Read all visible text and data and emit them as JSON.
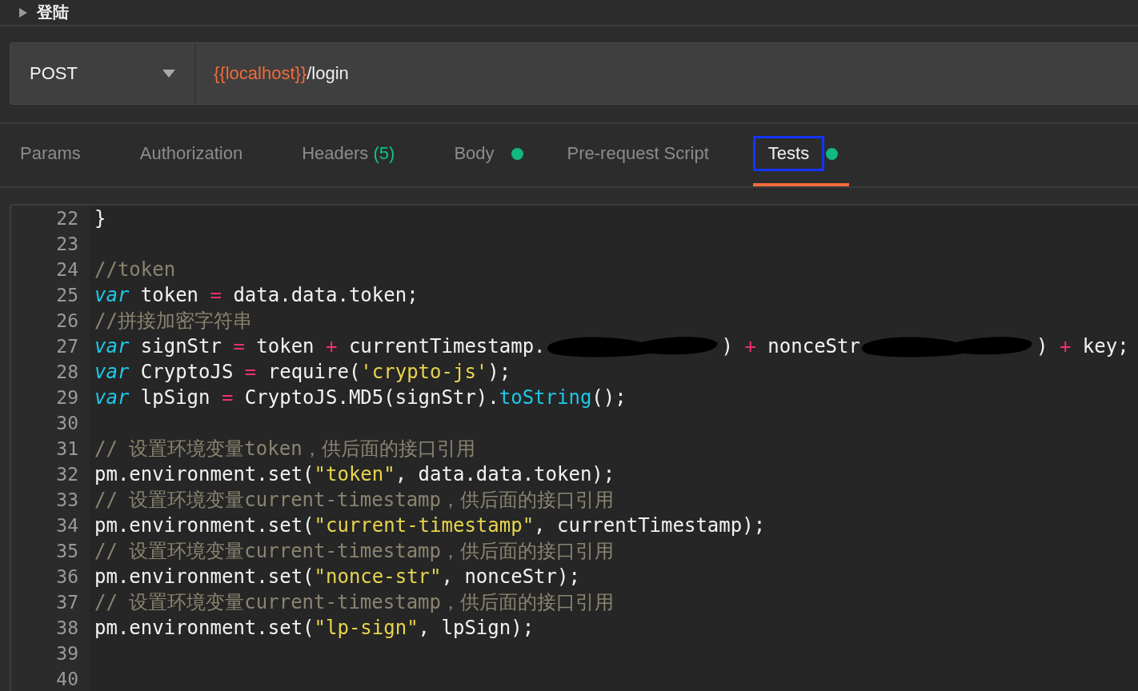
{
  "request": {
    "name": "登陆",
    "method": "POST",
    "url_variable": "{{localhost}}",
    "url_path": "/login"
  },
  "tabs": [
    {
      "label": "Params",
      "selected": false,
      "dot": false,
      "annotated": false
    },
    {
      "label": "Authorization",
      "selected": false,
      "dot": false,
      "annotated": false
    },
    {
      "label": "Headers",
      "count": "(5)",
      "selected": false,
      "dot": false,
      "annotated": false
    },
    {
      "label": "Body",
      "selected": false,
      "dot": true,
      "annotated": false
    },
    {
      "label": "Pre-request Script",
      "selected": false,
      "dot": false,
      "annotated": false
    },
    {
      "label": "Tests",
      "selected": true,
      "dot": true,
      "annotated": true
    }
  ],
  "editor": {
    "lines": [
      {
        "number": "22",
        "tokens": [
          {
            "kind": "plain",
            "t": "}"
          }
        ]
      },
      {
        "number": "23"
      },
      {
        "number": "24",
        "tokens": [
          {
            "kind": "comment",
            "t": "//token"
          }
        ]
      },
      {
        "number": "25",
        "tokens": [
          {
            "kind": "keyword",
            "t": "var"
          },
          {
            "kind": "plain",
            "t": " token "
          },
          {
            "kind": "op",
            "t": "="
          },
          {
            "kind": "plain",
            "t": " data.data.token;"
          }
        ]
      },
      {
        "number": "26",
        "tokens": [
          {
            "kind": "comment",
            "t": "//拼接加密字符串"
          }
        ]
      },
      {
        "number": "27",
        "tokens": [
          {
            "kind": "keyword",
            "t": "var"
          },
          {
            "kind": "plain",
            "t": " signStr "
          },
          {
            "kind": "op",
            "t": "="
          },
          {
            "kind": "plain",
            "t": " token "
          },
          {
            "kind": "op",
            "t": "+"
          },
          {
            "kind": "plain",
            "t": " currentTimestamp."
          },
          {
            "kind": "redacted"
          },
          {
            "kind": "plain",
            "t": ") "
          },
          {
            "kind": "op",
            "t": "+"
          },
          {
            "kind": "plain",
            "t": " nonceStr"
          },
          {
            "kind": "redacted"
          },
          {
            "kind": "plain",
            "t": ") "
          },
          {
            "kind": "op",
            "t": "+"
          },
          {
            "kind": "plain",
            "t": " key;"
          }
        ]
      },
      {
        "number": "28",
        "tokens": [
          {
            "kind": "keyword",
            "t": "var"
          },
          {
            "kind": "plain",
            "t": " CryptoJS "
          },
          {
            "kind": "op",
            "t": "="
          },
          {
            "kind": "plain",
            "t": " require("
          },
          {
            "kind": "string",
            "t": "'crypto-js'"
          },
          {
            "kind": "plain",
            "t": ");"
          }
        ]
      },
      {
        "number": "29",
        "tokens": [
          {
            "kind": "keyword",
            "t": "var"
          },
          {
            "kind": "plain",
            "t": " lpSign "
          },
          {
            "kind": "op",
            "t": "="
          },
          {
            "kind": "plain",
            "t": " CryptoJS.MD5(signStr)."
          },
          {
            "kind": "method",
            "t": "toString"
          },
          {
            "kind": "plain",
            "t": "();"
          }
        ]
      },
      {
        "number": "30"
      },
      {
        "number": "31",
        "tokens": [
          {
            "kind": "comment",
            "t": "// 设置环境变量token，供后面的接口引用"
          }
        ]
      },
      {
        "number": "32",
        "tokens": [
          {
            "kind": "plain",
            "t": "pm.environment.set("
          },
          {
            "kind": "string",
            "t": "\"token\""
          },
          {
            "kind": "plain",
            "t": ", data.data.token);"
          }
        ]
      },
      {
        "number": "33",
        "tokens": [
          {
            "kind": "comment",
            "t": "// 设置环境变量current-timestamp，供后面的接口引用"
          }
        ]
      },
      {
        "number": "34",
        "tokens": [
          {
            "kind": "plain",
            "t": "pm.environment.set("
          },
          {
            "kind": "string",
            "t": "\"current-timestamp\""
          },
          {
            "kind": "plain",
            "t": ", currentTimestamp);"
          }
        ]
      },
      {
        "number": "35",
        "tokens": [
          {
            "kind": "comment",
            "t": "// 设置环境变量current-timestamp，供后面的接口引用"
          }
        ]
      },
      {
        "number": "36",
        "tokens": [
          {
            "kind": "plain",
            "t": "pm.environment.set("
          },
          {
            "kind": "string",
            "t": "\"nonce-str\""
          },
          {
            "kind": "plain",
            "t": ", nonceStr);"
          }
        ]
      },
      {
        "number": "37",
        "tokens": [
          {
            "kind": "comment",
            "t": "// 设置环境变量current-timestamp，供后面的接口引用"
          }
        ]
      },
      {
        "number": "38",
        "tokens": [
          {
            "kind": "plain",
            "t": "pm.environment.set("
          },
          {
            "kind": "string",
            "t": "\"lp-sign\""
          },
          {
            "kind": "plain",
            "t": ", lpSign);"
          }
        ]
      },
      {
        "number": "39"
      },
      {
        "number": "40"
      }
    ]
  }
}
